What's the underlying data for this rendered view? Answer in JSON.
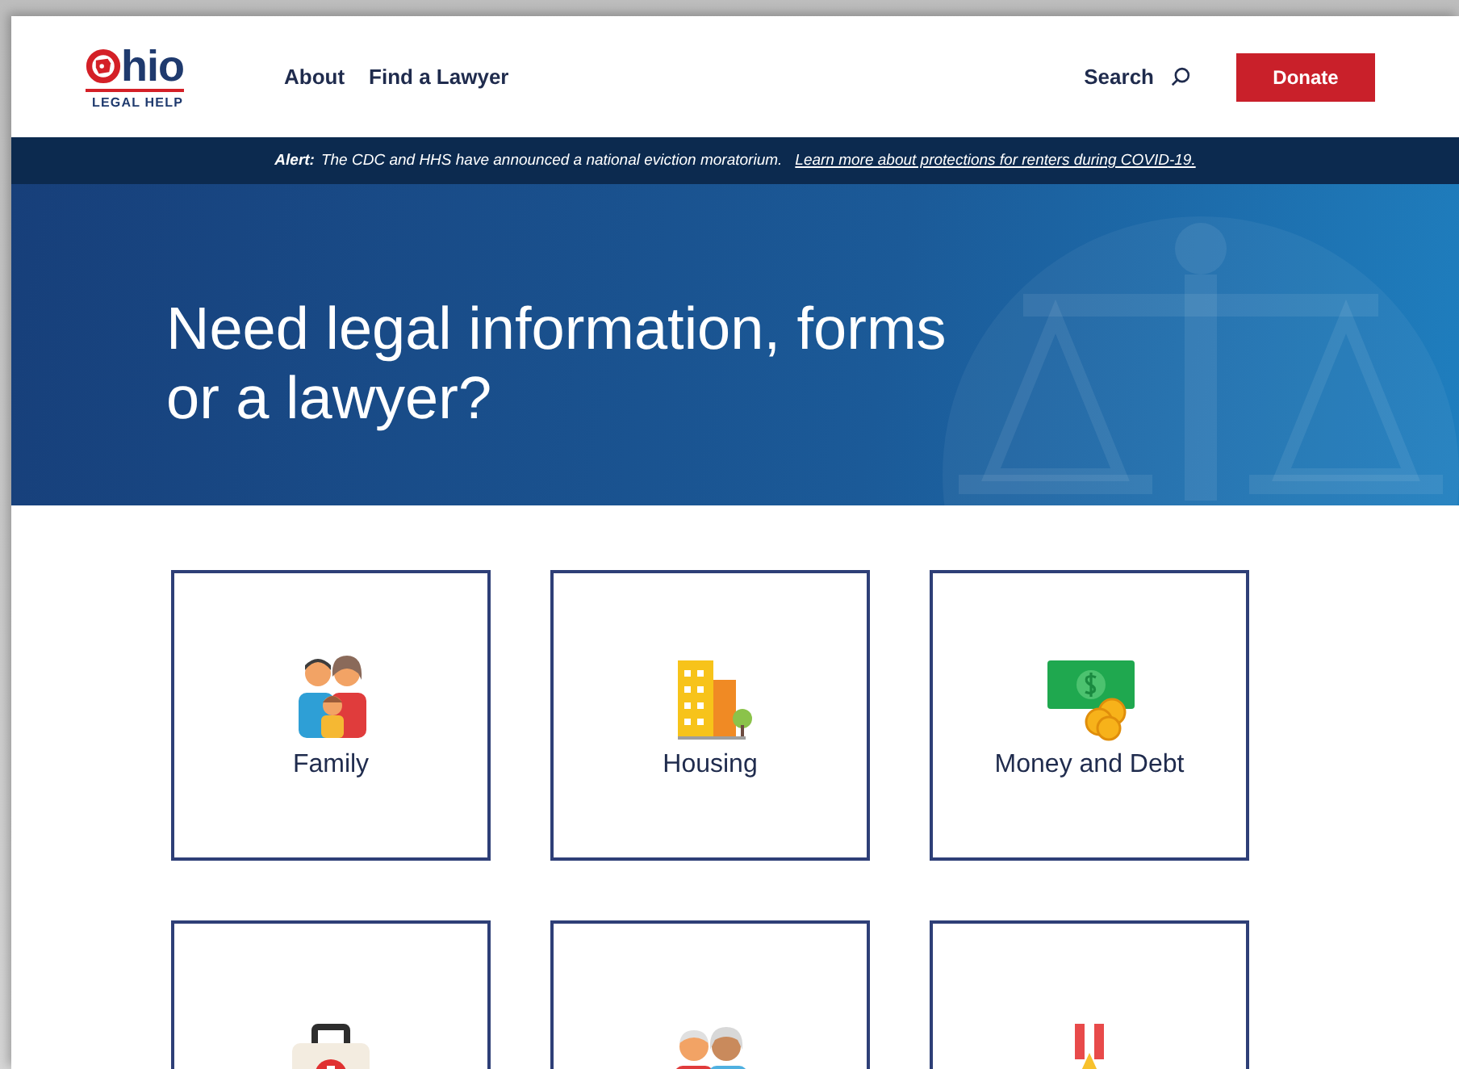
{
  "header": {
    "logo": {
      "word": "hio",
      "tagline": "LEGAL HELP"
    },
    "nav": [
      {
        "label": "About"
      },
      {
        "label": "Find a Lawyer"
      }
    ],
    "search": {
      "label": "Search"
    },
    "donate": {
      "label": "Donate"
    }
  },
  "alert": {
    "label": "Alert:",
    "text": "The CDC and HHS have announced a national eviction moratorium.",
    "link": "Learn more about protections for renters during COVID-19."
  },
  "hero": {
    "heading": "Need legal information, forms or a lawyer?"
  },
  "cards": [
    {
      "kind": "labelled",
      "label": "Family"
    },
    {
      "kind": "labelled",
      "label": "Housing"
    },
    {
      "kind": "labelled",
      "label": "Money and Debt"
    },
    {
      "kind": "icon-only"
    },
    {
      "kind": "icon-only"
    },
    {
      "kind": "icon-only"
    }
  ]
}
